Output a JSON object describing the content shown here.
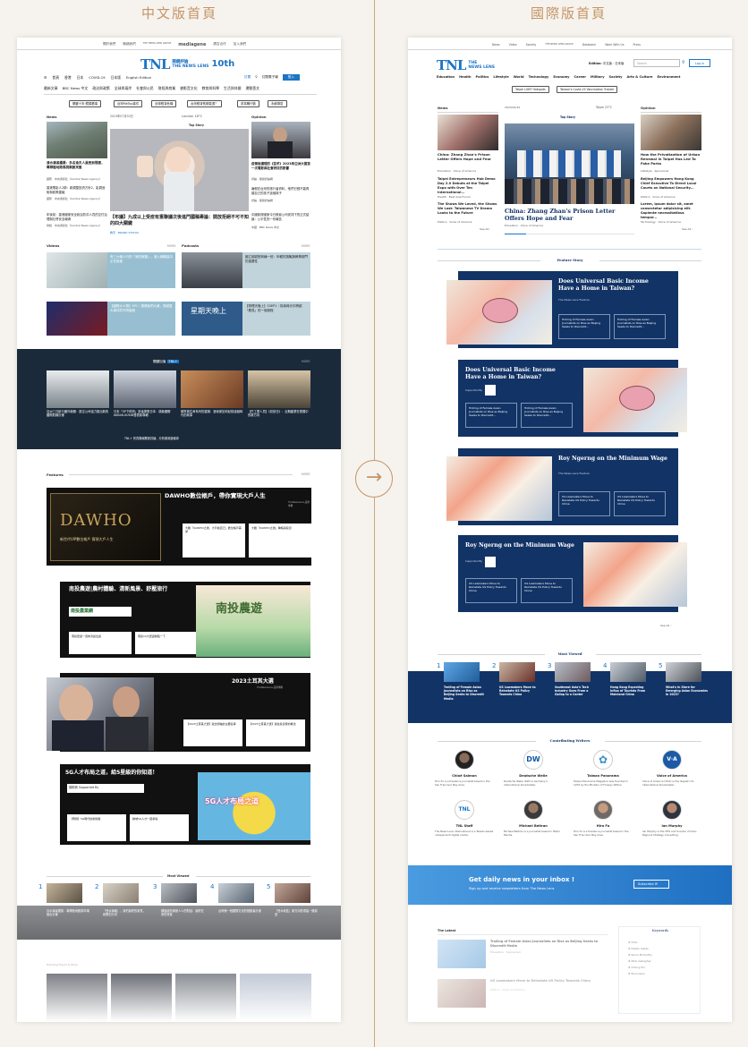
{
  "labels": {
    "left": "中文版首頁",
    "right": "國際版首頁"
  },
  "left": {
    "topbar": {
      "links": [
        "關於我們",
        "聯絡我們",
        "廣告合作",
        "加入我們"
      ],
      "group": "mediagene",
      "sub": "THE NEWS LENS GROUP"
    },
    "logo": {
      "main": "TNL",
      "sub1": "關鍵評論",
      "sub2": "THE NEWS LENS",
      "tag": "10th"
    },
    "edition": {
      "items": [
        "首頁",
        "香港",
        "日本",
        "COVID-19",
        "日本版",
        "English Edition"
      ],
      "login": "登入",
      "actions": [
        "訂閱",
        "訂閱電子報"
      ]
    },
    "nav": [
      "最新文章",
      "BBC News 中文",
      "政治與政策",
      "全球與兩岸",
      "社會與公民",
      "財經與商業",
      "書影音文化",
      "教育與科學",
      "生活與休閒",
      "運動藝文"
    ],
    "chips": [
      "關鍵十年·鏡頭看事",
      "台灣MeToo事件",
      "全球經濟危機",
      "台灣經濟長期衰退？",
      "求真職行動",
      "永續專區"
    ],
    "news": {
      "label": "News",
      "more": "MORE",
      "date": "2023年07月30日",
      "weather": "London 18°C",
      "items": [
        {
          "title": "清水溝溪獲獎：多名漁夫人員受到殘害，專隊陸地跑馬視察數來賓",
          "meta": "國際 · 中央通訊社（Central News Agency）"
        },
        {
          "title": "香港電影人2師：新調整投資方針2，影劇藝術與政策建議",
          "meta": "國際 · 中央通訊社（Central News Agency）"
        },
        {
          "title": "年後前：香港國家安全政治防洪人員的交付治理與社會安全報導",
          "meta": "財經 · 中央通訊社（Central News Agency）"
        }
      ]
    },
    "topstory": {
      "label": "Top Story",
      "title": "【布議】九成以上受疫有重聯議次後進門國稿專論：開放拒絕不可不知的四大關鍵",
      "meta": "教育 · BRAND STUDIO"
    },
    "opinion": {
      "label": "Opinion",
      "items": [
        {
          "title": "疫情後護理的《芸芊》2023年亞洲大賞第一次電影與社會研討的影響",
          "meta": "評論 · 關鍵評論網"
        },
        {
          "title": "暑假在台灣的旅行者資料，他們已經不能再讓自己的孩子這個樣子",
          "meta": "評論 · 關鍵評論網"
        },
        {
          "title": "中國政府國家今日數據公司安排下的正式結論：公平性的一份報告",
          "meta": "中國 · BBC News 中文"
        }
      ]
    },
    "videos": {
      "label": "Videos",
      "more": "MORE",
      "items": [
        {
          "title": "有三大個人行的「我的家團」，進入網絡高中正在前進"
        },
        {
          "title": "【國際大人物】SP1｜穩健者們大道，穿越重大事件的不同面貌"
        }
      ]
    },
    "podcasts": {
      "label": "Podcasts",
      "more": "MORE",
      "items": [
        {
          "title": "國立超越型刺練一班：年輕的挑戰與教學部門的重要性"
        },
        {
          "title": "【物理天晚上】S3EP1｜探索時光中跨越「看見」的一個旅程"
        }
      ],
      "show": "星期天晚上"
    },
    "dark": {
      "title": "關鍵加值",
      "badge": "TNL+",
      "more": "MORE",
      "items": [
        {
          "title": "亞洲三日航行國外新聞：航空公司強力推出新的國際航線計畫"
        },
        {
          "title": "日本「SP下修資」到達專業日本：偶像團體AKB48-XUIUB發表新專輯"
        },
        {
          "title": "頓寧與生命系列的重構：藝術家如何紀錄這個時代的故事"
        },
        {
          "title": "【巴工業人員】《初戀日》：近期產業在發展中的新方向"
        }
      ],
      "footer": "TNL+ 會員專屬獨家評論，分析與深度報導"
    },
    "features": {
      "label": "Features",
      "more": "MORE",
      "items": [
        {
          "title": "DAWHO數位帳戶，帶你實現大戶人生",
          "sponsor": "TheNewsLens 品牌專欄",
          "art": "DAWHO",
          "sub": "新世代VIP數位帳戶 實現大戶人生",
          "links": [
            "大膽「DAWHO之後，大戶給自己」數位帳戶需求",
            "大膽「DAWHO之後」轉帳與投資"
          ]
        },
        {
          "title": "南投農遊|農村體驗、清新風景、舒壓旅行",
          "sponsor": "南投農業網",
          "art": "南投農遊",
          "links": [
            "南投農遊一週末清晨出遊",
            "南投10大農遊體驗一下"
          ]
        },
        {
          "title": "2023土耳其大選",
          "sponsor": "TheNewsLens 品牌專欄",
          "links": [
            "【2023土耳其大選】政治領袖的主要競爭",
            "【2023土耳其大選】過往投資者的看法"
          ]
        },
        {
          "title": "5G人才布局之道，給5星級的你知道！",
          "sponsor": "贊助商 Supported By",
          "art": "5G人才布局之道",
          "links": [
            "【專題】5G時代的新挑戰",
            "跨域5G人才一起參與"
          ]
        }
      ]
    },
    "mostviewed": {
      "label": "Most Viewed",
      "items": [
        {
          "n": "1",
          "title": "清水溝溪獲獎：專隊陸地跑馬市場推出計畫"
        },
        {
          "n": "2",
          "title": "「西水溝報」，我們最終的看見，政策的方向"
        },
        {
          "n": "3",
          "title": "蘇福政府與他人人的對話：最終在家的聲音"
        },
        {
          "n": "4",
          "title": "台灣第一個國際文化的推動者計畫"
        },
        {
          "n": "5",
          "title": "「西水地區」新方向的重建一路前進"
        }
      ]
    },
    "trending": {
      "label": "Trending Topics & More"
    }
  },
  "right": {
    "topbar": {
      "links": [
        "News",
        "Video",
        "Society",
        "Databank",
        "Work With Us",
        "Press"
      ]
    },
    "logo": {
      "main": "TNL",
      "sub1": "THE",
      "sub2": "NEWS LENS"
    },
    "edition": {
      "label": "Edition:",
      "ops": "中文版 · 日本版",
      "search": "Search",
      "login": "Log in"
    },
    "nav": [
      "Education",
      "Health",
      "Politics",
      "Lifestyle",
      "World",
      "Technology",
      "Economy",
      "Career",
      "Military",
      "Society",
      "Arts & Culture",
      "Environment"
    ],
    "chips": [
      "Taipei LGBT Hotspots",
      "Taiwan's Covid-19 Vaccination Tracker"
    ],
    "news": {
      "label": "News",
      "items": [
        {
          "title": "China: Zhang Zhan's Prison Letter Offers Hope and Fear",
          "meta": "Education · Voice of America"
        },
        {
          "title": "Taipei Entrepreneurs Hub Demo Day 2.0 Debuts at the Taipei Expo with Over Ten International...",
          "meta": "Health · East Asia Forum"
        },
        {
          "title": "The Shows We Loved, the Shows We Lost: Taiwanese TV Drama Looks to the Future",
          "meta": "Politics · Voice of America"
        }
      ],
      "see": "See All"
    },
    "topstory": {
      "label": "Top Story",
      "date": "2023/03/10",
      "weather": "Taipei 23°C",
      "title": "China: Zhang Zhan's Prison Letter Offers Hope and Fear",
      "meta": "Education · Voice of America"
    },
    "opinion": {
      "label": "Opinion",
      "items": [
        {
          "title": "How the Privatization of Urban Renewal in Taipei Has Led To Fake Parks",
          "meta": "Lifestyle · Sponsored"
        },
        {
          "title": "Beijing Empowers Hong Kong Chief Executive To Direct Local Courts on National Security...",
          "meta": "Politics · Voice of America"
        },
        {
          "title": "Lorem, ipsum dolor sit, amet consectetur adipisicing elit. Sapiente necessitatibus tempor...",
          "meta": "Technology · Voice of America"
        }
      ],
      "see": "See All"
    },
    "feature": {
      "label": "Feature Story",
      "items": [
        {
          "title": "Does Universal Basic Income Have a Home in Taiwan?",
          "src": "The News Lens Feature",
          "subs": [
            "Trolling of Female Asian Journalists on Rise as Beijing Seeks to Discredit...",
            "Trolling of Female Asian Journalists on Rise as Beijing Seeks to Discredit..."
          ]
        },
        {
          "title": "Does Universal Basic Income Have a Home in Taiwan?",
          "src": "Supported By",
          "subs": [
            "Trolling of Female Asian Journalists on Rise as Beijing Seeks to Discredit...",
            "Trolling of Female Asian Journalists on Rise as Beijing Seeks to Discredit..."
          ]
        },
        {
          "title": "Roy Ngerng on the Minimum Wage",
          "src": "The News Lens Feature",
          "subs": [
            "US Lawmakers Move to Reinstate US Policy Towards China",
            "US Lawmakers Move to Reinstate US Policy Towards China"
          ]
        },
        {
          "title": "Roy Ngerng on the Minimum Wage",
          "src": "Supported By",
          "subs": [
            "US Lawmakers Move to Reinstate US Policy Towards China",
            "US Lawmakers Move to Reinstate US Policy Towards China"
          ]
        }
      ],
      "see": "See All"
    },
    "mostviewed": {
      "label": "Most Viewed",
      "items": [
        {
          "n": "1",
          "title": "Trolling of Female Asian Journalists on Rise as Beijing Seeks to Discredit Media"
        },
        {
          "n": "2",
          "title": "US Lawmakers Move to Reinstate US Policy Towards China"
        },
        {
          "n": "3",
          "title": "Southeast Asia's Tech Industry Goes From a Gallop to a Canter"
        },
        {
          "n": "4",
          "title": "Hong Kong Expecting Influx of Tourists From Mainland China"
        },
        {
          "n": "5",
          "title": "What's in Store for Emerging Asian Economies in 2023?"
        }
      ]
    },
    "writers": {
      "label": "Contributing Writers",
      "items": [
        {
          "name": "Chloé Salmon",
          "bio": "Hiro Fu is a freelance journalist based in the San Francisco Bay Area."
        },
        {
          "name": "Deutsche Welle",
          "bio": "Deutsche Welle (DW) is Germany's international broadcaster."
        },
        {
          "name": "Taiwan Panorama",
          "bio": "Taiwan Panorama Magazine was founded in 1976 by the Ministry of Foreign Affairs."
        },
        {
          "name": "Voice of America",
          "bio": "Voice of America (VOA) is the largest U.S. international broadcaster."
        },
        {
          "name": "TNL Staff",
          "bio": "The News Lens International is a Taiwan-based independent digital media."
        },
        {
          "name": "Michael Beltran",
          "bio": "Michael Beltran is a journalist based in Metro Manila."
        },
        {
          "name": "Hiro Fu",
          "bio": "Hiro Fu is a freelance journalist based in the San Francisco Bay Area."
        },
        {
          "name": "Ian Murphy",
          "bio": "Ian Murphy is the CEO and founder of Inter-Regions Strategy Consulting."
        }
      ]
    },
    "subscribe": {
      "title": "Get daily news in your inbox !",
      "sub": "Sign up and receive newsletters from The News Lens",
      "btn": "Subscribe"
    },
    "latest": {
      "label": "The Latest",
      "items": [
        {
          "title": "Trolling of Female Asian Journalists on Rise as Beijing Seeks to Discredit Media",
          "meta": "Education · Sponsored"
        },
        {
          "title": "US Lawmakers Move to Reinstate US Policy Towards China",
          "meta": "Politics · Voice of America"
        }
      ]
    },
    "keywords": {
      "label": "Keywords",
      "items": [
        "Ohio",
        "Dalian Gates",
        "Kevin McCarthy",
        "Mick Gallagher",
        "Chong Ton",
        "Eurovision"
      ]
    }
  },
  "colors": {
    "accent": "#c49466",
    "brand": "#1c74c4",
    "navy": "#123365"
  }
}
